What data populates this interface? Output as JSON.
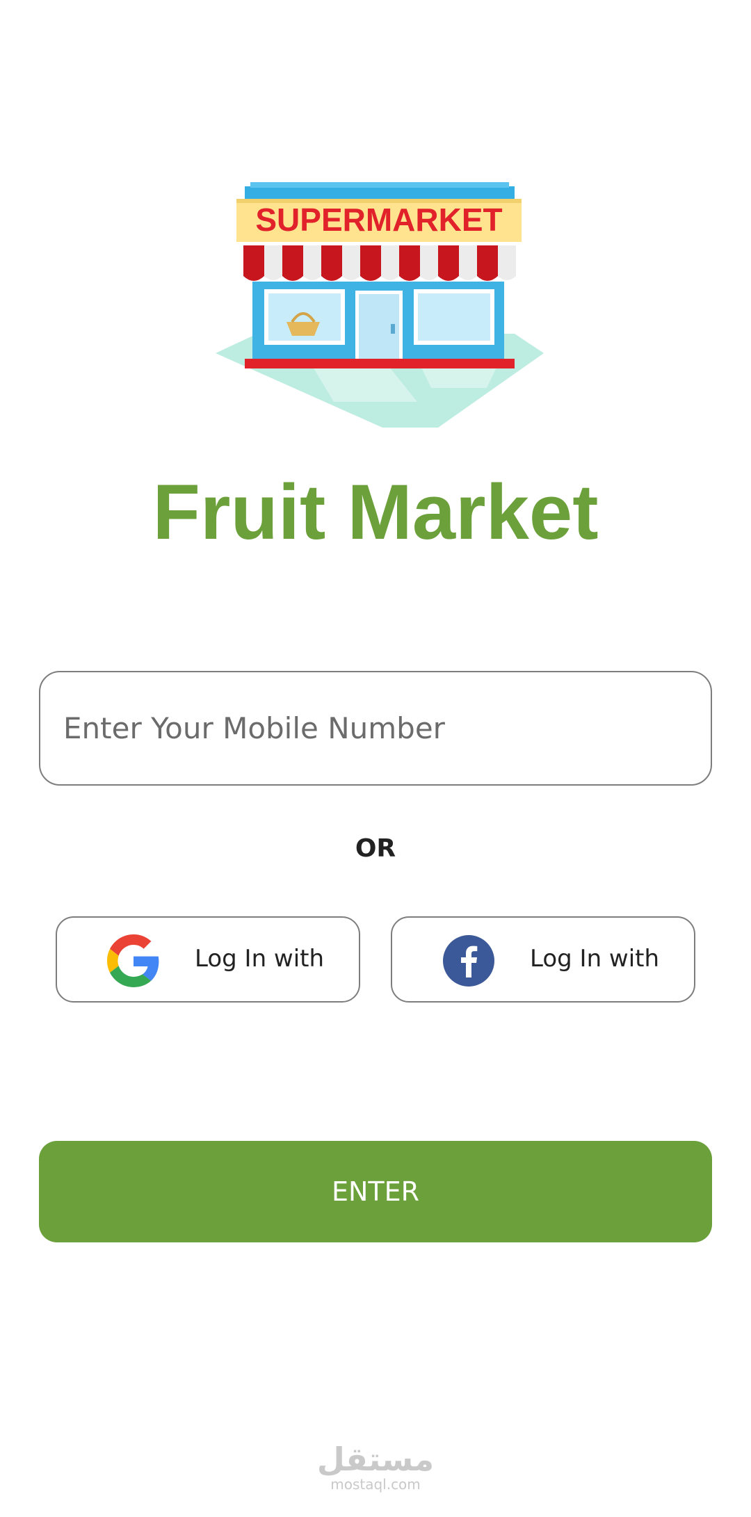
{
  "logo": {
    "sign_text": "SUPERMARKET"
  },
  "app": {
    "title": "Fruit Market"
  },
  "form": {
    "mobile_placeholder": "Enter Your Mobile Number",
    "mobile_value": ""
  },
  "divider": {
    "label": "OR"
  },
  "social": {
    "google": {
      "icon": "google-icon",
      "label": "Log In with"
    },
    "facebook": {
      "icon": "facebook-icon",
      "label": "Log In with"
    }
  },
  "actions": {
    "enter_label": "ENTER"
  },
  "watermark": {
    "arabic": "مستقل",
    "latin": "mostaql.com"
  },
  "colors": {
    "brand_green": "#6ba03a",
    "facebook_blue": "#3b5998",
    "border_gray": "#7d7d7d"
  }
}
